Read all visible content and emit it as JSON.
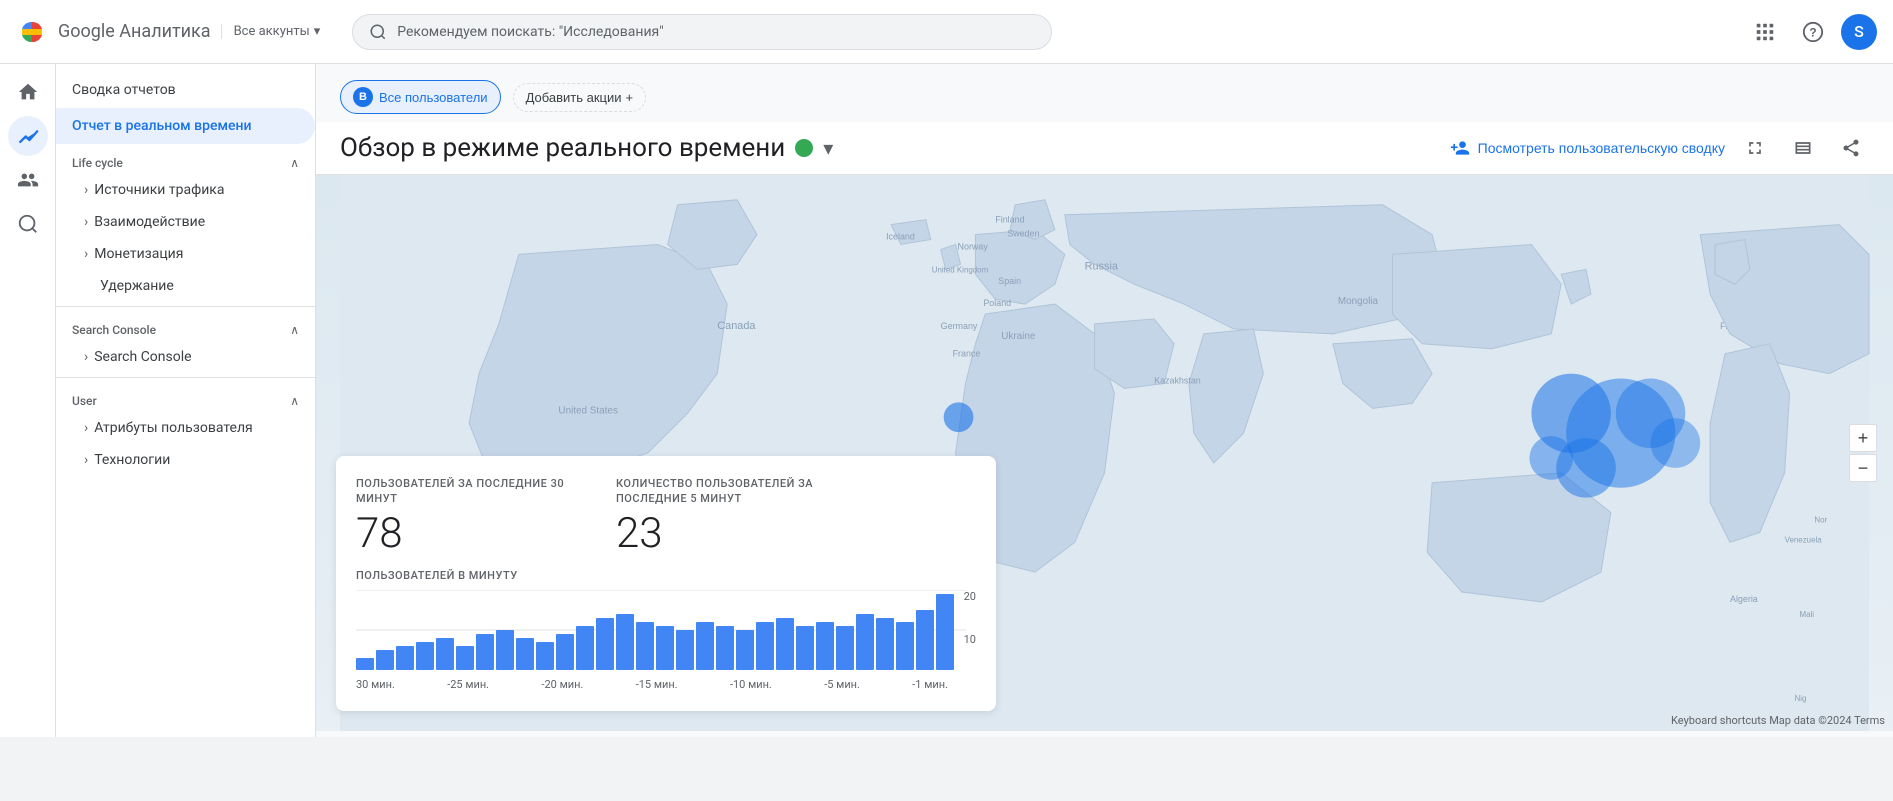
{
  "app": {
    "name": "Google Аналитика",
    "logoTitle": "Google Аналитика"
  },
  "topnav": {
    "account_label": "Все аккунты",
    "search_placeholder": "Рекомендуем поискать: \"Исследования\"",
    "avatar_letter": "S"
  },
  "sidebar": {
    "summary_label": "Сводка отчетов",
    "realtime_label": "Отчет в реальном времени",
    "sections": [
      {
        "id": "lifecycle",
        "title": "Life cycle",
        "items": [
          {
            "label": "Источники трафика"
          },
          {
            "label": "Взаимодействие"
          },
          {
            "label": "Монетизация"
          },
          {
            "label": "Удержание"
          }
        ]
      },
      {
        "id": "search_console",
        "title": "Search Console",
        "items": [
          {
            "label": "Search Console"
          }
        ]
      },
      {
        "id": "user",
        "title": "User",
        "items": [
          {
            "label": "Атрибуты пользователя"
          },
          {
            "label": "Технологии"
          }
        ]
      }
    ]
  },
  "header": {
    "segment_label": "Все пользователи",
    "add_segment_label": "Добавить акции",
    "page_title": "Обзор в режиме реального времени",
    "user_summary_label": "Посмотреть пользовательскую сводку"
  },
  "stats": {
    "users_30min_label": "ПОЛЬЗОВАТЕЛЕЙ ЗА ПОСЛЕДНИЕ 30 МИНУТ",
    "users_30min_value": "78",
    "users_5min_label": "КОЛИЧЕСТВО ПОЛЬЗОВАТЕЛЕЙ ЗА ПОСЛЕДНИЕ 5 МИНУТ",
    "users_5min_value": "23",
    "users_per_min_label": "ПОЛЬЗОВАТЕЛЕЙ В МИНУТУ",
    "y_axis": [
      "20",
      "10"
    ],
    "x_axis": [
      "30 мин.",
      "-25 мин.",
      "-20 мин.",
      "-15 мин.",
      "-10 мин.",
      "-5 мин.",
      "-1 мин."
    ]
  },
  "chart": {
    "bars": [
      3,
      5,
      6,
      7,
      8,
      6,
      9,
      10,
      8,
      7,
      9,
      11,
      13,
      14,
      12,
      11,
      10,
      12,
      11,
      10,
      12,
      13,
      11,
      12,
      11,
      14,
      13,
      12,
      15,
      19
    ]
  },
  "map": {
    "footer": "Keyboard shortcuts   Map data ©2024   Terms"
  },
  "icons": {
    "home": "⌂",
    "realtime": "📊",
    "audience": "👤",
    "acquisition": "📈",
    "behavior": "🔍",
    "search_dot": "●",
    "chevron_down": "▾",
    "chevron_right": "›",
    "plus": "+",
    "expand": "⌃",
    "collapse": "⌄",
    "apps": "⠿",
    "help": "?",
    "fullscreen": "⛶",
    "compare": "▦",
    "share": "↑",
    "person_add": "👤+"
  }
}
